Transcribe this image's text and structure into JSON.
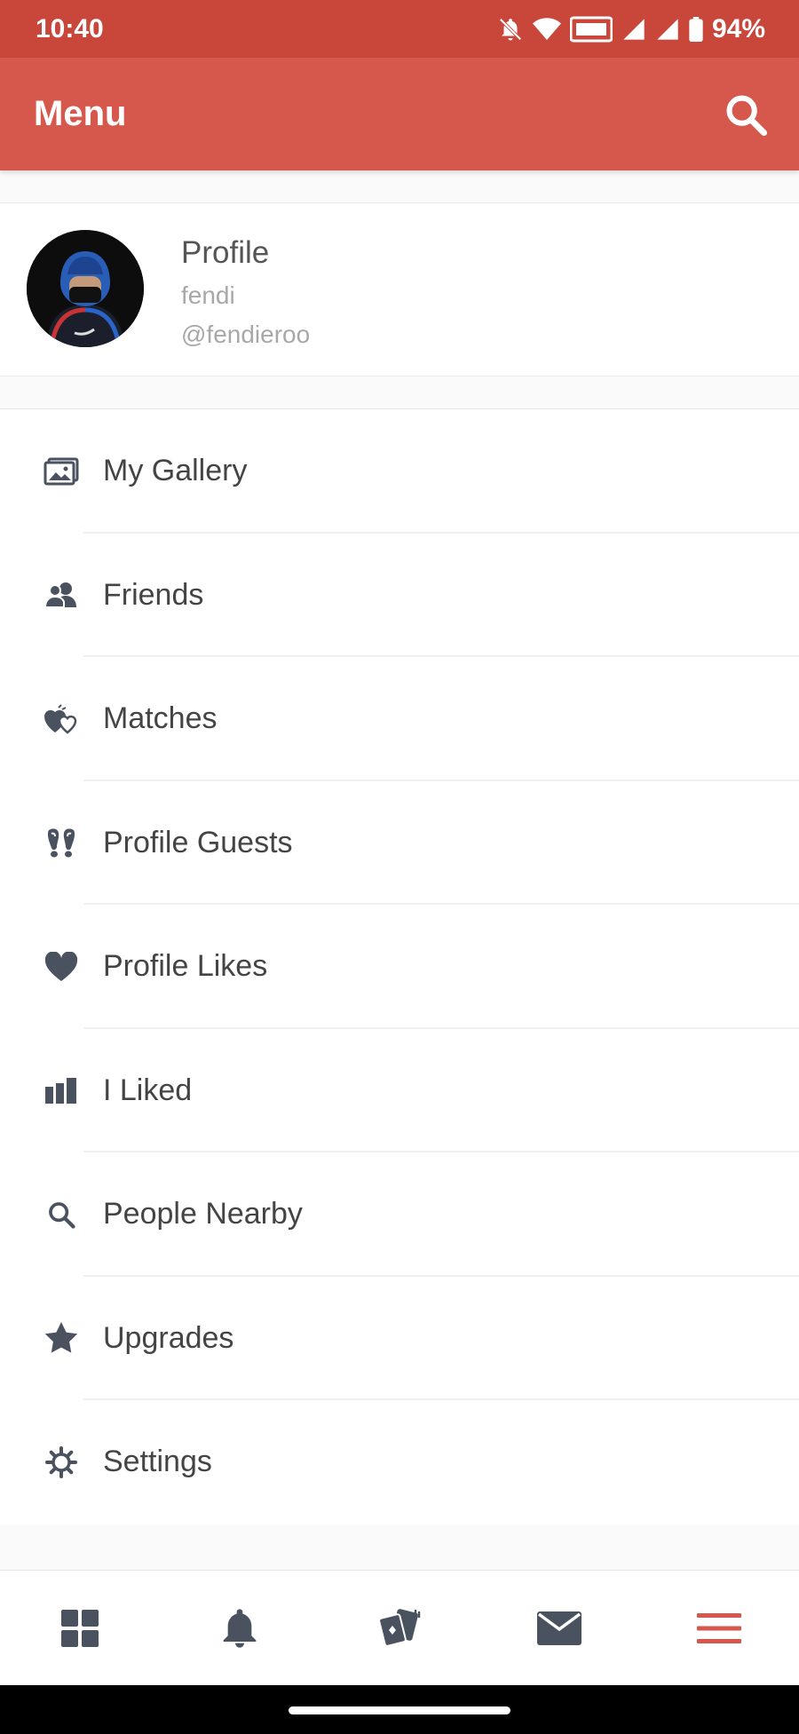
{
  "status_bar": {
    "time": "10:40",
    "battery": "94%"
  },
  "app_bar": {
    "title": "Menu"
  },
  "profile": {
    "title": "Profile",
    "name": "fendi",
    "handle": "@fendieroo"
  },
  "menu": {
    "items": [
      {
        "label": "My Gallery",
        "icon": "gallery-icon"
      },
      {
        "label": "Friends",
        "icon": "friends-icon"
      },
      {
        "label": "Matches",
        "icon": "matches-icon"
      },
      {
        "label": "Profile Guests",
        "icon": "footprints-icon"
      },
      {
        "label": "Profile Likes",
        "icon": "heart-icon"
      },
      {
        "label": "I Liked",
        "icon": "thumbs-up-icon"
      },
      {
        "label": "People Nearby",
        "icon": "search-icon"
      },
      {
        "label": "Upgrades",
        "icon": "star-icon"
      },
      {
        "label": "Settings",
        "icon": "gear-icon"
      }
    ]
  },
  "bottom_nav": {
    "items": [
      "grid-icon",
      "bell-icon",
      "cards-icon",
      "mail-icon",
      "menu-icon"
    ],
    "active": "menu-icon"
  },
  "colors": {
    "status_bar": "#c9463b",
    "app_bar": "#d6584c",
    "accent": "#d6584c",
    "icon": "#4a5260"
  }
}
